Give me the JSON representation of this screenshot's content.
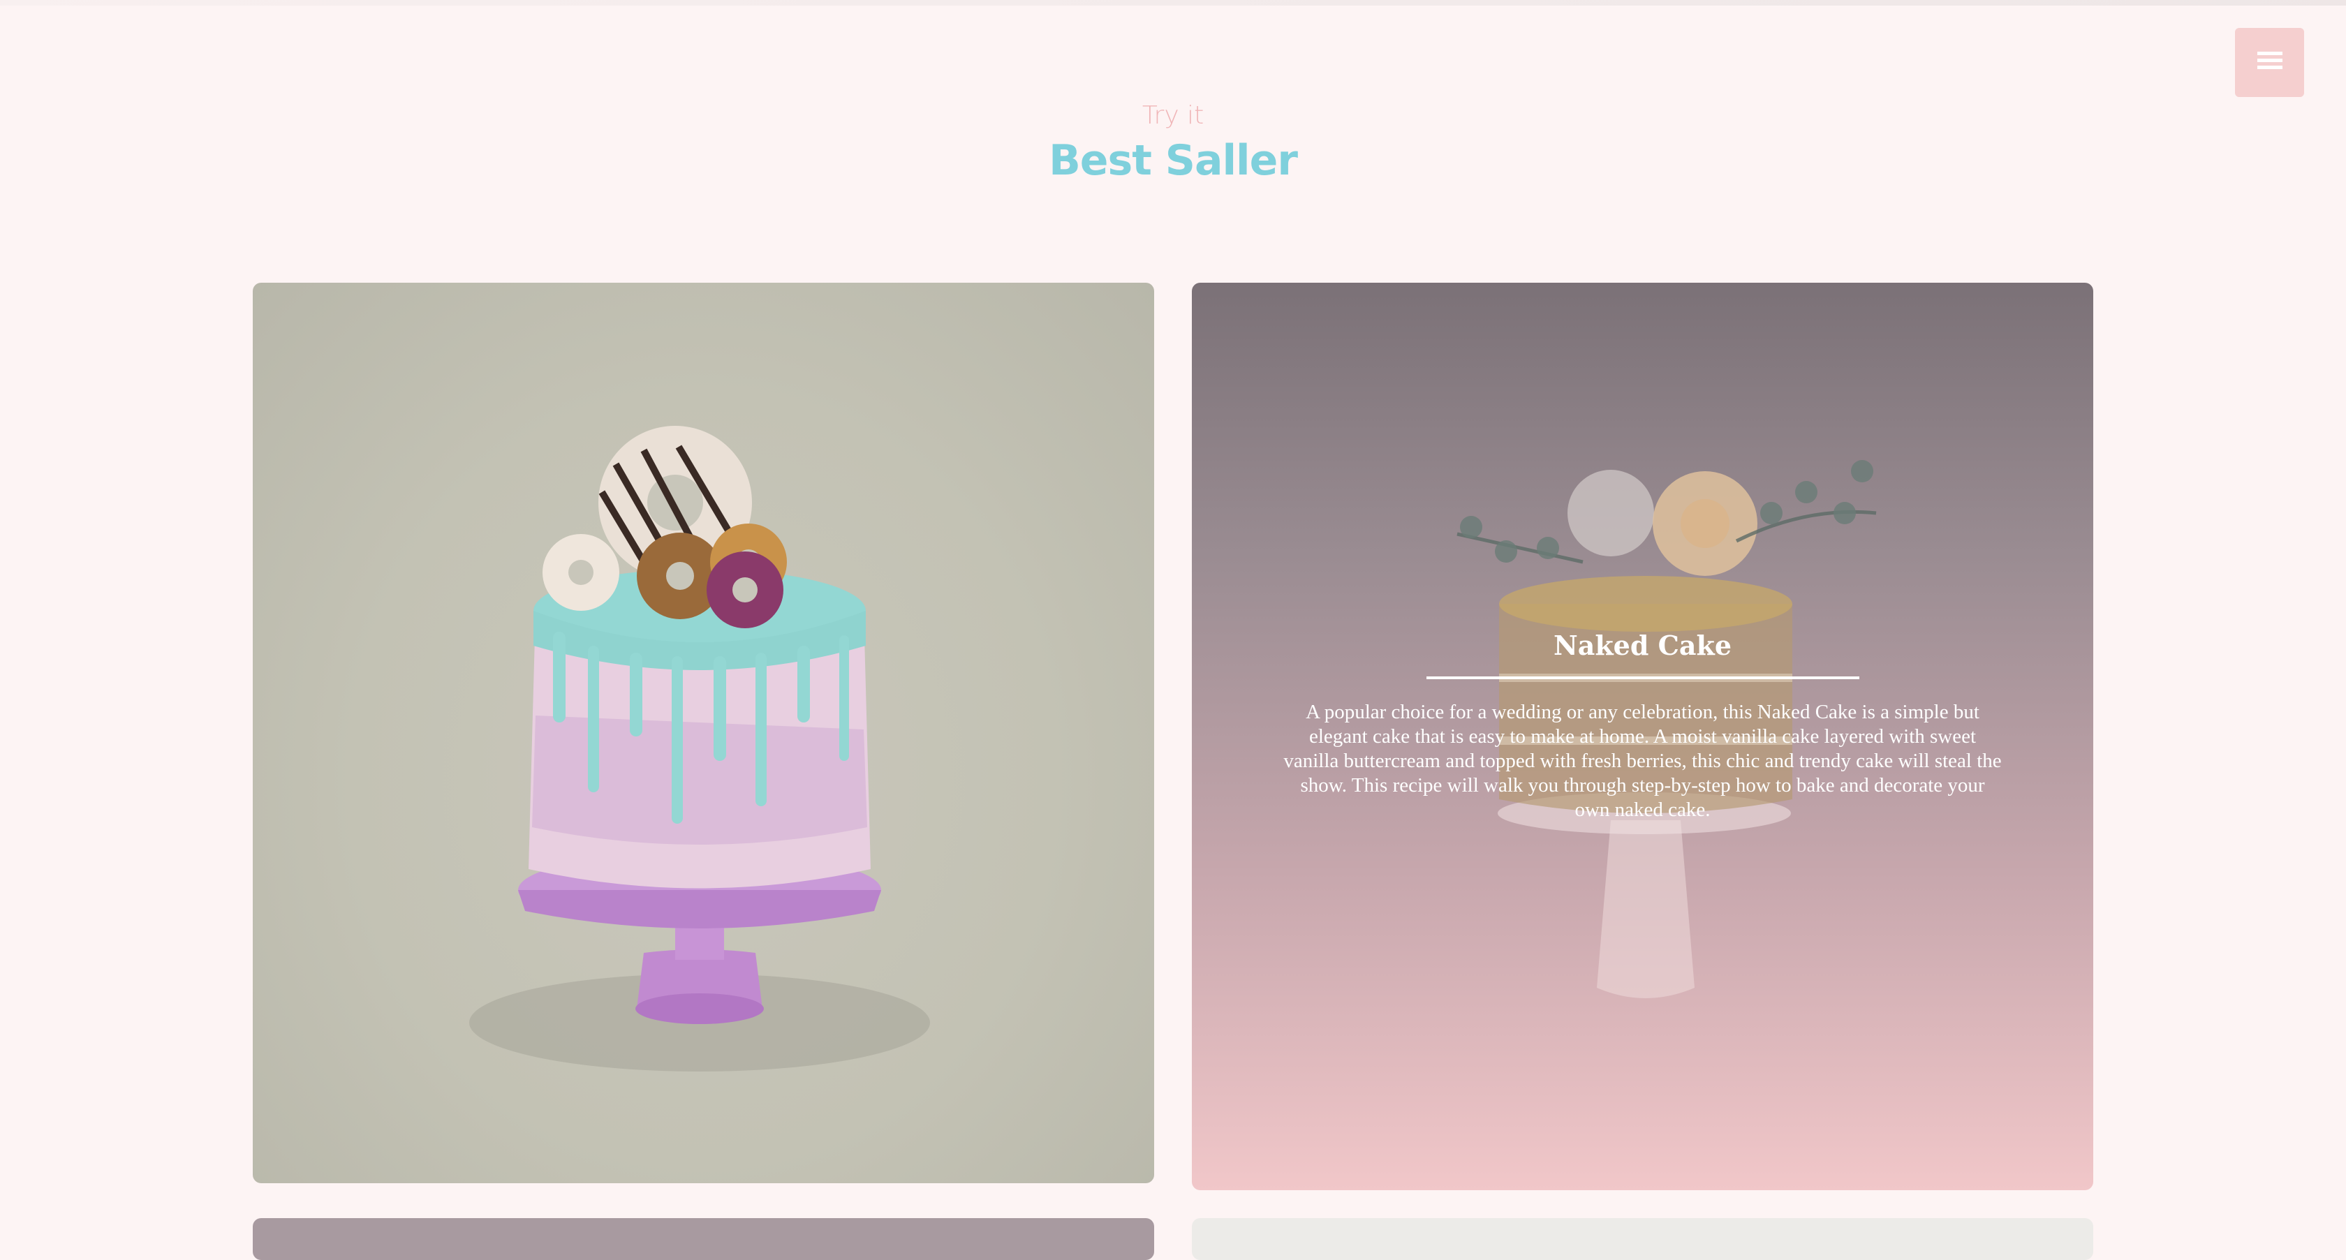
{
  "header": {
    "menu_icon": "hamburger-menu-icon"
  },
  "section": {
    "eyebrow": "Try it",
    "title": "Best Saller"
  },
  "cards": [
    {
      "image": "drip-cake-with-donuts"
    },
    {
      "image": "naked-cake-with-roses",
      "title": "Naked Cake",
      "description": "A popular choice for a wedding or any celebration, this Naked Cake is a simple but elegant cake that is easy to make at home. A moist vanilla cake layered with sweet vanilla buttercream and topped with fresh berries, this chic and trendy cake will steal the show. This recipe will walk you through step-by-step how to bake and decorate your own naked cake."
    }
  ],
  "colors": {
    "page_background": "#fdf4f4",
    "eyebrow": "#f0b6b8",
    "title": "#7fd0dc",
    "menu_button": "#f5cfcf"
  }
}
